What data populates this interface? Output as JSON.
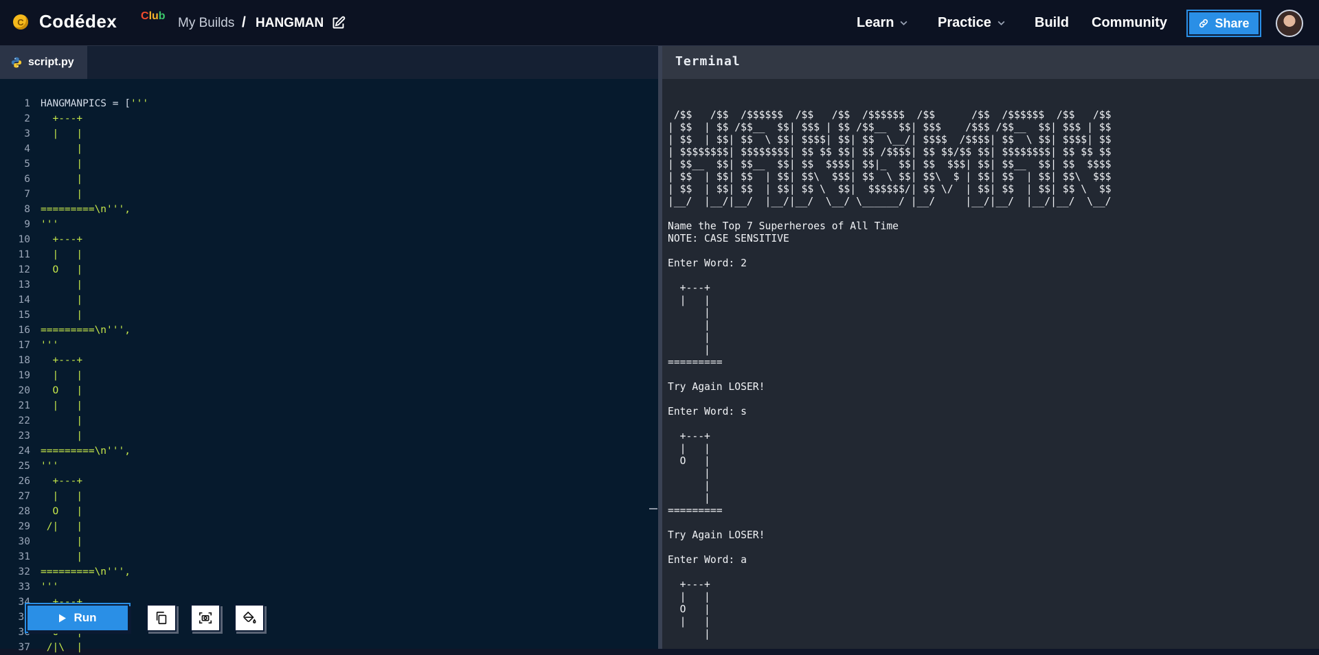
{
  "header": {
    "logo_coin": "C",
    "logo_text": "Codédex",
    "logo_club": [
      "C",
      "lu",
      "b"
    ],
    "breadcrumb_builds": "My Builds",
    "breadcrumb_sep": "/",
    "project_title": "HANGMAN",
    "nav": {
      "learn": "Learn",
      "practice": "Practice",
      "build": "Build",
      "community": "Community"
    },
    "share_label": "Share"
  },
  "editor": {
    "tab_label": "script.py",
    "run_label": "Run",
    "lines": [
      "HANGMANPICS = ['''",
      "  +---+",
      "  |   |",
      "      |",
      "      |",
      "      |",
      "      |",
      "=========\\n''',",
      "'''",
      "  +---+",
      "  |   |",
      "  O   |",
      "      |",
      "      |",
      "      |",
      "=========\\n''',",
      "'''",
      "  +---+",
      "  |   |",
      "  O   |",
      "  |   |",
      "      |",
      "      |",
      "=========\\n''',",
      "'''",
      "  +---+",
      "  |   |",
      "  O   |",
      " /|   |",
      "      |",
      "      |",
      "=========\\n''',",
      "'''",
      "  +---+",
      "  |   |",
      "  O   |",
      " /|\\  |"
    ]
  },
  "terminal": {
    "title": "Terminal",
    "output": " /$$   /$$  /$$$$$$  /$$   /$$  /$$$$$$  /$$      /$$  /$$$$$$  /$$   /$$\n| $$  | $$ /$$__  $$| $$$ | $$ /$$__  $$| $$$    /$$$ /$$__  $$| $$$ | $$\n| $$  | $$| $$  \\ $$| $$$$| $$| $$  \\__/| $$$$  /$$$$| $$  \\ $$| $$$$| $$\n| $$$$$$$$| $$$$$$$$| $$ $$ $$| $$ /$$$$| $$ $$/$$ $$| $$$$$$$$| $$ $$ $$\n| $$__  $$| $$__  $$| $$  $$$$| $$|_  $$| $$  $$$| $$| $$__  $$| $$  $$$$\n| $$  | $$| $$  | $$| $$\\  $$$| $$  \\ $$| $$\\  $ | $$| $$  | $$| $$\\  $$$\n| $$  | $$| $$  | $$| $$ \\  $$|  $$$$$$/| $$ \\/  | $$| $$  | $$| $$ \\  $$\n|__/  |__/|__/  |__/|__/  \\__/ \\______/ |__/     |__/|__/  |__/|__/  \\__/\n\nName the Top 7 Superheroes of All Time\nNOTE: CASE SENSITIVE\n\nEnter Word: 2\n\n  +---+\n  |   |\n      |\n      |\n      |\n      |\n=========\n\nTry Again LOSER!\n\nEnter Word: s\n\n  +---+\n  |   |\n  O   |\n      |\n      |\n      |\n=========\n\nTry Again LOSER!\n\nEnter Word: a\n\n  +---+\n  |   |\n  O   |\n  |   |\n      |"
  },
  "colors": {
    "accent_blue": "#2a8fe6",
    "code_string": "#c6e84a",
    "editor_bg": "#061a2d",
    "terminal_bg": "#222832"
  },
  "icons": [
    "codedex-coin-icon",
    "edit-icon",
    "chevron-down-icon",
    "link-icon",
    "python-icon",
    "play-icon",
    "copy-icon",
    "screenshot-icon",
    "paint-bucket-icon"
  ]
}
